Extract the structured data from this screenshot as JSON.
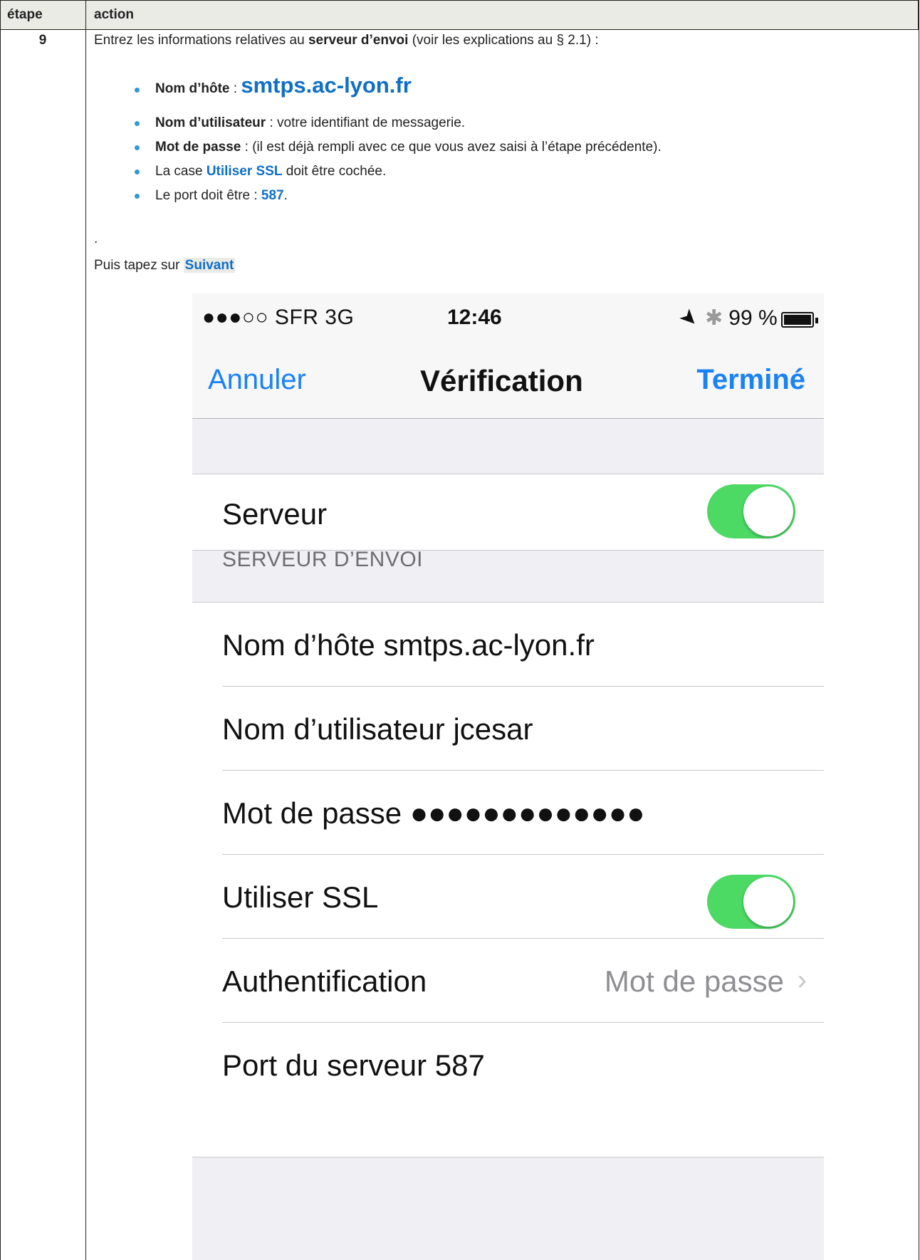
{
  "table": {
    "header_step": "étape",
    "header_action": "action",
    "step_number": "9"
  },
  "intro": {
    "before": "Entrez les informations relatives au ",
    "bold": "serveur d’envoi",
    "after": " (voir les explications au § 2.1) :"
  },
  "bullets": [
    {
      "bold": "Nom d’hôte",
      "sep": " : ",
      "value": "smtps.ac-lyon.fr"
    },
    {
      "bold": "Nom d’utilisateur",
      "rest": " : votre identifiant de messagerie."
    },
    {
      "bold": "Mot de passe",
      "rest": " : (il est déjà rempli avec ce que vous avez saisi à l’étape précédente)."
    },
    {
      "pre": "La case ",
      "blue": "Utiliser SSL",
      "rest": " doit être cochée."
    },
    {
      "pre": "Le port doit être : ",
      "blue": "587",
      "rest": "."
    }
  ],
  "stray_dot": ".",
  "puis": {
    "text": "Puis tapez sur ",
    "button": "Suivant"
  },
  "phone": {
    "status": {
      "signal": "●●●○○ SFR  3G",
      "time": "12:46",
      "arrow": "➤",
      "bluetooth": "✱",
      "battery": "99 %"
    },
    "nav": {
      "cancel": "Annuler",
      "title": "Vérification",
      "done": "Terminé"
    },
    "server_label": "Serveur",
    "server_on": true,
    "section_header": "SERVEUR D’ENVOI",
    "rows": {
      "hostname": "Nom d’hôte  smtps.ac-lyon.fr",
      "username": "Nom d’utilisateur  jcesar",
      "password": "Mot de passe  ●●●●●●●●●●●●●",
      "ssl": "Utiliser SSL",
      "auth_label": "Authentification",
      "auth_value": "Mot de passe",
      "port": "Port du serveur  587"
    },
    "ssl_on": true,
    "chevron": "›"
  },
  "colors": {
    "link_blue": "#0f6fc6",
    "ios_blue": "#1a82f7",
    "toggle_green": "#4cd964",
    "bullet_blue": "#2e9bd6"
  }
}
